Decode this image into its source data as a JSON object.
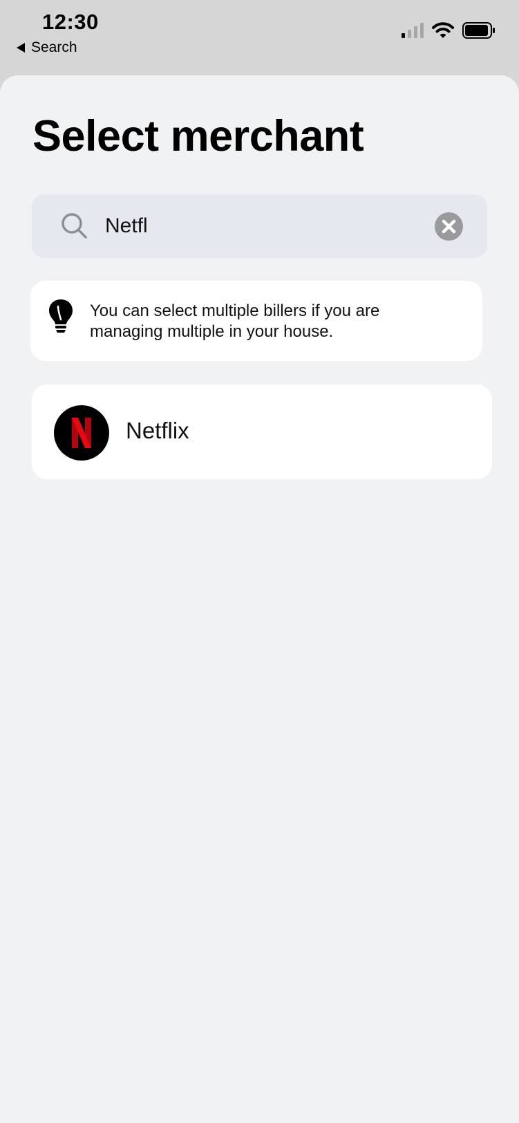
{
  "status_bar": {
    "time": "12:30",
    "back_label": "Search",
    "icons": [
      "cellular-signal-icon",
      "wifi-icon",
      "battery-icon"
    ]
  },
  "page": {
    "title": "Select merchant"
  },
  "search": {
    "value": "Netfl",
    "icon": "search-icon",
    "clear_icon": "clear-icon"
  },
  "tip": {
    "icon": "lightbulb-icon",
    "text": "You can select multiple billers if you are managing multiple in your house."
  },
  "results": [
    {
      "name": "Netflix",
      "logo": "netflix-logo",
      "logo_colors": {
        "background": "#000000",
        "accent": "#e50914"
      }
    }
  ],
  "colors": {
    "top_bar": "#d6d6d6",
    "sheet": "#f1f2f4",
    "search_bg": "#e5e8ef",
    "card": "#ffffff"
  }
}
